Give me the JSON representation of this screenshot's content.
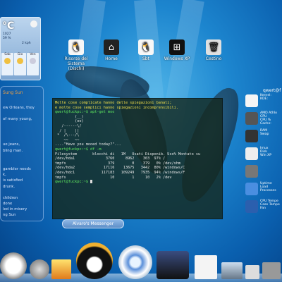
{
  "weather": {
    "temp": "°C",
    "pressure": "1027",
    "humidity": "59 %",
    "wind": "2 kph",
    "days": [
      "Sab",
      "Gio",
      "Ven"
    ]
  },
  "lyrics": {
    "title": "Sung Sun",
    "lines": [
      "ew Orleans, they",
      "",
      "of many young,",
      "",
      "",
      "ue jeans,",
      "bling man.",
      "",
      "",
      "gambler needs",
      "k,",
      "is satisfied",
      "drunk.",
      "",
      "children",
      "done",
      "led in misery",
      "ng Sun"
    ]
  },
  "desktop_icons": [
    {
      "label": "Risorse del Sistema (Dischi)",
      "icon": "tux-icon"
    },
    {
      "label": "Home",
      "icon": "home-icon"
    },
    {
      "label": "Sbt",
      "icon": "tux-icon"
    },
    {
      "label": "Windows XP",
      "icon": "windows-icon"
    },
    {
      "label": "Cestino",
      "icon": "trash-icon"
    }
  ],
  "terminal": {
    "lines": [
      {
        "t": "Molte cose complicate hanno delle spiegazioni banali;",
        "c": "y"
      },
      {
        "t": "e molte cose semplici hanno spiegazioni incomprensibili.",
        "c": "y"
      },
      {
        "t": "qwert@fuckpc:~$ apt-get moo",
        "c": "g"
      },
      {
        "t": "         (__)",
        "c": ""
      },
      {
        "t": "         (oo)",
        "c": ""
      },
      {
        "t": "   /------\\/",
        "c": ""
      },
      {
        "t": "  / |    ||",
        "c": ""
      },
      {
        "t": " *  /\\---/\\",
        "c": ""
      },
      {
        "t": "    ~~   ~~",
        "c": ""
      },
      {
        "t": "....\"Have you mooed today?\"...",
        "c": ""
      },
      {
        "t": "qwert@fuckpc:~$ df -m",
        "c": "g"
      },
      {
        "t": "Filesystem       blocchi di   1M   Usati Disponib. Uso% Montato su",
        "c": ""
      },
      {
        "t": "/dev/hda1              3760     8962    303  97% /",
        "c": ""
      },
      {
        "t": "tmpfs                   379        0    379   0% /dev/shm",
        "c": ""
      },
      {
        "t": "/dev/hda2             17116    13675   3442  80% /windows/C",
        "c": ""
      },
      {
        "t": "/dev/hdc1            117183   109249   7935  94% /windows/F",
        "c": ""
      },
      {
        "t": "tmpfs                    10        1     10   2% /dev",
        "c": ""
      },
      {
        "t": "qwert@fuckpc:~$ ",
        "c": "g"
      }
    ]
  },
  "messenger": "Alvaro's Messenger",
  "system": {
    "user": "qwert@f",
    "rows": [
      {
        "text": "Kernel:\nKDE:",
        "icon": "tux-icon"
      },
      {
        "text": "AMD Athlo\nCPU\nCPU %\nCache:",
        "icon": "cpu-icon"
      },
      {
        "text": "RAM\nSwap",
        "icon": "ram-icon"
      },
      {
        "text": "Imux\nDisk\nWin XP",
        "icon": "hard-disk-icon"
      },
      {
        "text": "",
        "icon": "drive-icon"
      },
      {
        "text": "Uptime\nLoad\nProcesses",
        "icon": "clock-icon"
      },
      {
        "text": "CPU Tempe\nCase Tempe\nFan",
        "icon": "thermometer-icon"
      }
    ]
  },
  "dock": [
    "clock-app",
    "media-player",
    "stamps-app",
    "tux-messenger",
    "itunes-app",
    "film-app",
    "text-editor",
    "image-viewer",
    "terminal-app"
  ]
}
